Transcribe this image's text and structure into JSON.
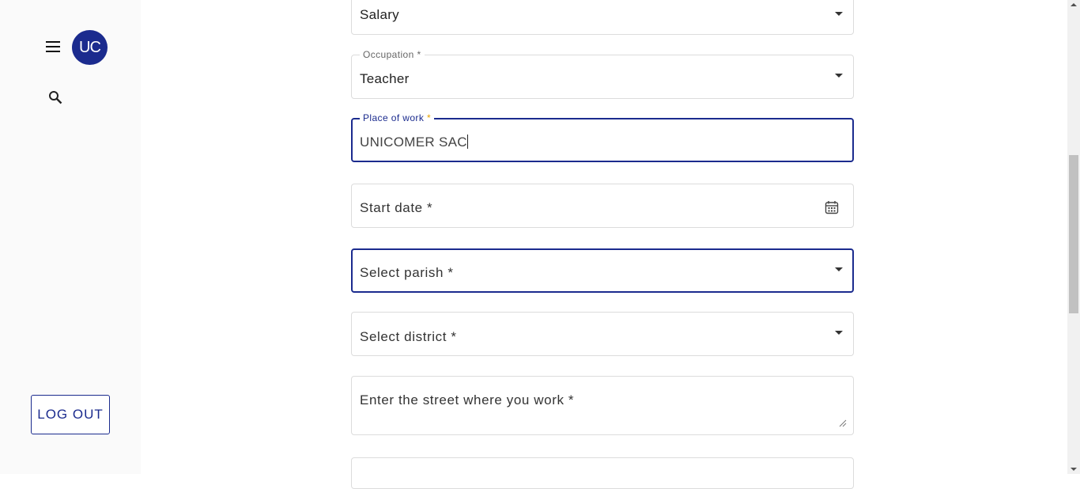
{
  "sidebar": {
    "avatar_text": "UC",
    "menu_icon": "hamburger-menu-icon",
    "search_icon": "search-icon",
    "logout_label": "LOG OUT"
  },
  "form": {
    "income_type": {
      "value": "Salary"
    },
    "occupation": {
      "label": "Occupation",
      "required_mark": "*",
      "value": "Teacher"
    },
    "place_of_work": {
      "label": "Place of work",
      "required_mark": "*",
      "value": "UNICOMER SAC"
    },
    "start_date": {
      "placeholder": "Start date *",
      "icon": "calendar-icon"
    },
    "parish": {
      "placeholder": "Select parish *"
    },
    "district": {
      "placeholder": "Select district *"
    },
    "street": {
      "placeholder": "Enter the street where you work *"
    }
  },
  "colors": {
    "accent": "#1b2b8e",
    "required_mark": "#e6a100",
    "sidebar_bg": "#fafafa"
  }
}
